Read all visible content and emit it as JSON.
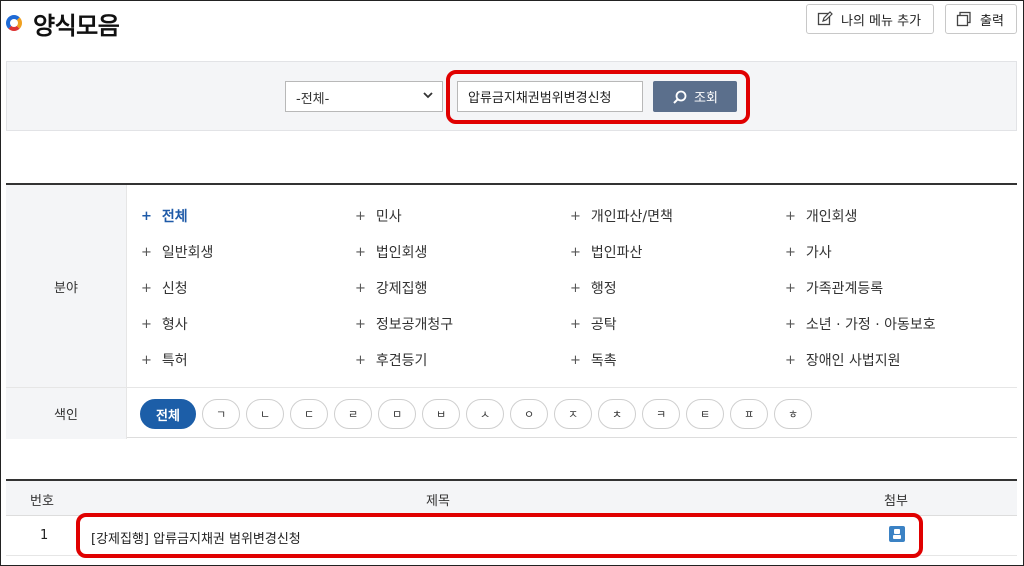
{
  "header": {
    "title": "양식모음",
    "add_menu_label": "나의 메뉴 추가",
    "print_label": "출력"
  },
  "search": {
    "category_selected": "-전체-",
    "query": "압류금지채권범위변경신청",
    "button_label": "조회"
  },
  "filters": {
    "field_label": "분야",
    "index_label": "색인",
    "fields": [
      "전체",
      "민사",
      "개인파산/면책",
      "개인회생",
      "일반회생",
      "법인회생",
      "법인파산",
      "가사",
      "신청",
      "강제집행",
      "행정",
      "가족관계등록",
      "형사",
      "정보공개청구",
      "공탁",
      "소년 · 가정 · 아동보호",
      "특허",
      "후견등기",
      "독촉",
      "장애인 사법지원"
    ],
    "active_field": "전체",
    "index_all": "전체",
    "index_letters": [
      "ㄱ",
      "ㄴ",
      "ㄷ",
      "ㄹ",
      "ㅁ",
      "ㅂ",
      "ㅅ",
      "ㅇ",
      "ㅈ",
      "ㅊ",
      "ㅋ",
      "ㅌ",
      "ㅍ",
      "ㅎ"
    ]
  },
  "results": {
    "columns": {
      "number": "번호",
      "title": "제목",
      "attachment": "첨부"
    },
    "rows": [
      {
        "number": "1",
        "title": "[강제집행] 압류금지채권 범위변경신청"
      }
    ]
  },
  "icons": {
    "add_menu": "edit-icon",
    "print": "print-icon",
    "search": "search-icon",
    "attachment": "file-icon"
  },
  "colors": {
    "accent": "#1c5ea8",
    "search_button": "#5b6f8c",
    "highlight": "#e00000"
  }
}
